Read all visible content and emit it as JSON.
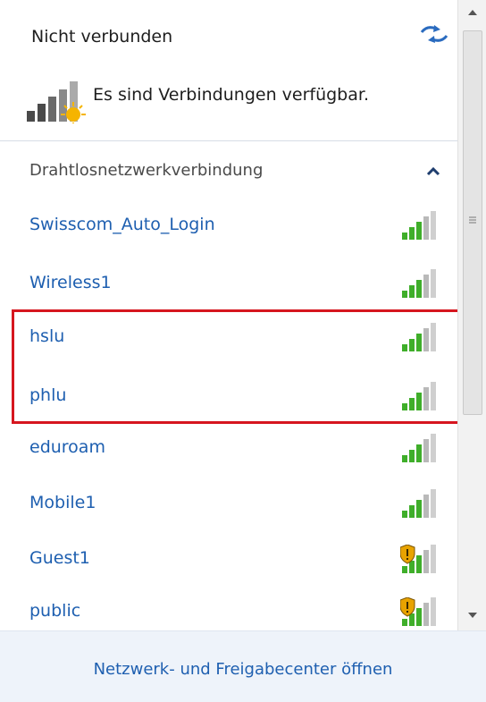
{
  "header": {
    "status": "Nicht verbunden",
    "availability": "Es sind Verbindungen verfügbar."
  },
  "section": {
    "title": "Drahtlosnetzwerkverbindung"
  },
  "networks": [
    {
      "name": "Swisscom_Auto_Login",
      "secured": false
    },
    {
      "name": "Wireless1",
      "secured": false
    },
    {
      "name": "hslu",
      "secured": false
    },
    {
      "name": "phlu",
      "secured": false
    },
    {
      "name": "eduroam",
      "secured": false
    },
    {
      "name": "Mobile1",
      "secured": false
    },
    {
      "name": "Guest1",
      "secured": true
    },
    {
      "name": "public",
      "secured": true
    }
  ],
  "footer": {
    "link": "Netzwerk- und Freigabecenter öffnen"
  },
  "colors": {
    "link": "#1e5fb0",
    "highlight": "#d6161f",
    "signal_green": "#3fae2a",
    "footer_bg": "#eef3fa"
  }
}
